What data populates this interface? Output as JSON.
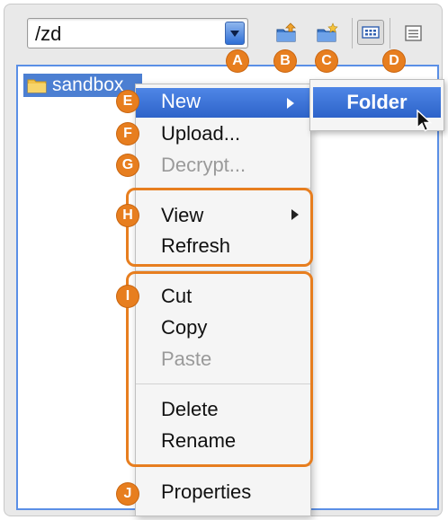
{
  "path": {
    "value": "/zd"
  },
  "explorer": {
    "folder_name": "sandbox"
  },
  "context_menu": {
    "items": [
      {
        "label": "New"
      },
      {
        "label": "Upload..."
      },
      {
        "label": "Decrypt..."
      },
      {
        "label": "View"
      },
      {
        "label": "Refresh"
      },
      {
        "label": "Cut"
      },
      {
        "label": "Copy"
      },
      {
        "label": "Paste"
      },
      {
        "label": "Delete"
      },
      {
        "label": "Rename"
      },
      {
        "label": "Properties"
      }
    ]
  },
  "submenu": {
    "items": [
      {
        "label": "Folder"
      }
    ]
  },
  "callouts": [
    "A",
    "B",
    "C",
    "D",
    "E",
    "F",
    "G",
    "H",
    "I",
    "J"
  ],
  "colors": {
    "accent": "#e77e1f",
    "selection": "#2d63c9",
    "explorer_border": "#5a8fe6"
  },
  "icons": {
    "toolbar": [
      "upload-folder-icon",
      "new-folder-icon",
      "grid-view-icon",
      "list-view-icon"
    ],
    "folder": "folder-icon",
    "cursor": "mouse-pointer-icon"
  }
}
